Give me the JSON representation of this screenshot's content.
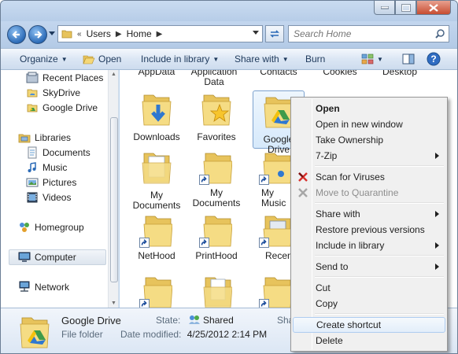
{
  "address": {
    "crumbs": [
      "Users",
      "Home"
    ],
    "search_placeholder": "Search Home"
  },
  "commands": {
    "organize": "Organize",
    "open": "Open",
    "include": "Include in library",
    "share": "Share with",
    "burn": "Burn"
  },
  "nav": {
    "recent": "Recent Places",
    "skydrive": "SkyDrive",
    "gdrive": "Google Drive",
    "libraries": "Libraries",
    "documents": "Documents",
    "music": "Music",
    "pictures": "Pictures",
    "videos": "Videos",
    "homegroup": "Homegroup",
    "computer": "Computer",
    "network": "Network"
  },
  "files": {
    "row0": [
      "AppData",
      "Application Data",
      "Contacts",
      "Cookies",
      "Desktop"
    ],
    "downloads": "Downloads",
    "favorites": "Favorites",
    "gdrive": "Google Drive",
    "mydocs1": "My Documents",
    "mydocs2": "My Documents",
    "mymusic": "My Music",
    "nethood": "NetHood",
    "printhood": "PrintHood",
    "recent": "Recent"
  },
  "details": {
    "name": "Google Drive",
    "type": "File folder",
    "state_label": "State:",
    "state_value": "Shared",
    "modified_label": "Date modified:",
    "modified_value": "4/25/2012 2:14 PM",
    "share_cut": "Sha"
  },
  "menu": {
    "open": "Open",
    "open_new": "Open in new window",
    "ownership": "Take Ownership",
    "zip": "7-Zip",
    "scan": "Scan for Viruses",
    "quarantine": "Move to Quarantine",
    "share": "Share with",
    "restore": "Restore previous versions",
    "include": "Include in library",
    "sendto": "Send to",
    "cut": "Cut",
    "copy": "Copy",
    "shortcut": "Create shortcut",
    "delete": "Delete"
  },
  "colors": {
    "folder": "#f2d675",
    "accent": "#2c6bb7",
    "selection": "#d6e9fb"
  }
}
